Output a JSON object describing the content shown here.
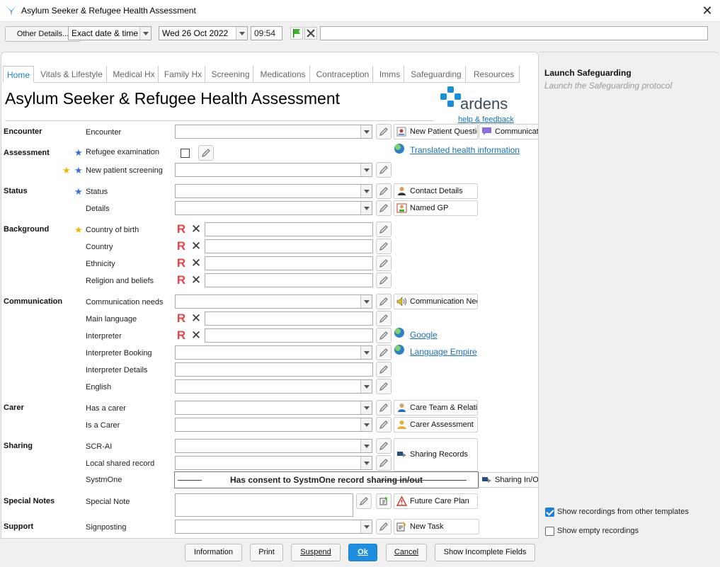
{
  "window": {
    "title": "Asylum Seeker & Refugee Health Assessment",
    "close_glyph": "✕"
  },
  "toolbar": {
    "other_details": "Other Details...",
    "date_mode": "Exact date & time",
    "date": "Wed 26 Oct 2022",
    "time": "09:54",
    "search_value": ""
  },
  "tabs": [
    {
      "label": "Home"
    },
    {
      "label": "Vitals & Lifestyle"
    },
    {
      "label": "Medical Hx"
    },
    {
      "label": "Family Hx"
    },
    {
      "label": "Screening"
    },
    {
      "label": "Medications"
    },
    {
      "label": "Contraception"
    },
    {
      "label": "Imms"
    },
    {
      "label": "Safeguarding"
    },
    {
      "label": "Resources"
    }
  ],
  "page": {
    "title": "Asylum Seeker & Refugee Health Assessment",
    "logo_text": "ardens",
    "help_link": "help & feedback"
  },
  "sections": {
    "encounter": "Encounter",
    "assessment": "Assessment",
    "status": "Status",
    "background": "Background",
    "communication": "Communication",
    "carer": "Carer",
    "sharing": "Sharing",
    "special_notes": "Special Notes",
    "support": "Support"
  },
  "labels": {
    "encounter": "Encounter",
    "refugee_examination": "Refugee examination",
    "new_patient_screening": "New patient screening",
    "status": "Status",
    "details": "Details",
    "country_of_birth": "Country of birth",
    "country": "Country",
    "ethnicity": "Ethnicity",
    "religion": "Religion and beliefs",
    "communication_needs": "Communication needs",
    "main_language": "Main language",
    "interpreter": "Interpreter",
    "interpreter_booking": "Interpreter Booking",
    "interpreter_details": "Interpreter Details",
    "english": "English",
    "has_a_carer": "Has a carer",
    "is_a_carer": "Is a Carer",
    "scr_ai": "SCR-AI",
    "local_shared_record": "Local shared record",
    "systmone": "SystmOne",
    "special_note": "Special Note",
    "signposting": "Signposting"
  },
  "actions": {
    "new_patient_questionnaire": "New Patient Questionnaire",
    "communication": "Communication",
    "translated_info": "Translated health information",
    "contact_details": "Contact Details",
    "named_gp": "Named GP",
    "communication_needs": "Communication Needs",
    "google": "Google",
    "language_empire": "Language Empire",
    "care_team": "Care Team & Relationships",
    "carer_assessment": "Carer Assessment",
    "sharing_records": "Sharing Records",
    "sharing_in_out": "Sharing In/Out",
    "future_care_plan": "Future Care Plan",
    "new_task": "New Task"
  },
  "consent_text": "Has consent to SystmOne record sharing in/out",
  "r_badge": "R",
  "x_glyph": "✕",
  "side": {
    "title": "Launch Safeguarding",
    "subtitle": "Launch the Safeguarding protocol",
    "show_other": "Show recordings from other templates",
    "show_empty": "Show empty recordings"
  },
  "footer": {
    "information": "Information",
    "print": "Print",
    "suspend": "Suspend",
    "ok": "Ok",
    "cancel": "Cancel",
    "show_incomplete": "Show Incomplete Fields"
  }
}
